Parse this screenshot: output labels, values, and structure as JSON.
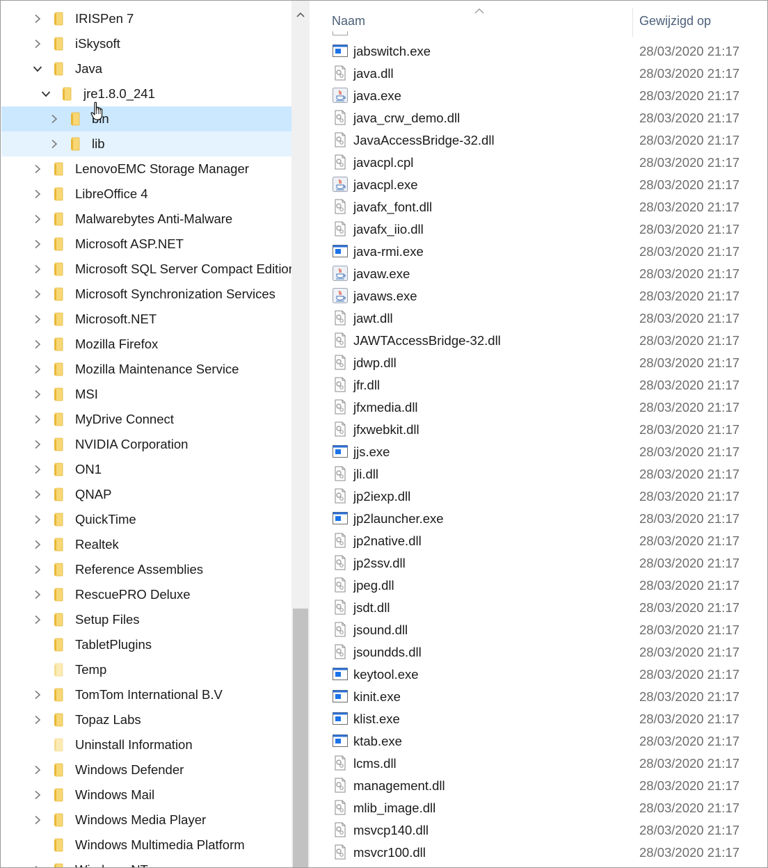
{
  "tree": {
    "items": [
      {
        "label": "IRISPen 7",
        "state": "collapsed",
        "depth": 0,
        "folder_style": "normal"
      },
      {
        "label": "iSkysoft",
        "state": "collapsed",
        "depth": 0,
        "folder_style": "normal"
      },
      {
        "label": "Java",
        "state": "expanded",
        "depth": 0,
        "folder_style": "normal"
      },
      {
        "label": "jre1.8.0_241",
        "state": "expanded",
        "depth": 1,
        "folder_style": "normal"
      },
      {
        "label": "bin",
        "state": "collapsed",
        "depth": 2,
        "folder_style": "normal",
        "selected": true
      },
      {
        "label": "lib",
        "state": "collapsed",
        "depth": 2,
        "folder_style": "normal",
        "hovered": true
      },
      {
        "label": "LenovoEMC Storage Manager",
        "state": "collapsed",
        "depth": 0,
        "folder_style": "normal"
      },
      {
        "label": "LibreOffice 4",
        "state": "collapsed",
        "depth": 0,
        "folder_style": "normal"
      },
      {
        "label": "Malwarebytes Anti-Malware",
        "state": "collapsed",
        "depth": 0,
        "folder_style": "normal"
      },
      {
        "label": "Microsoft ASP.NET",
        "state": "collapsed",
        "depth": 0,
        "folder_style": "normal"
      },
      {
        "label": "Microsoft SQL Server Compact Edition",
        "state": "collapsed",
        "depth": 0,
        "folder_style": "normal"
      },
      {
        "label": "Microsoft Synchronization Services",
        "state": "collapsed",
        "depth": 0,
        "folder_style": "normal"
      },
      {
        "label": "Microsoft.NET",
        "state": "collapsed",
        "depth": 0,
        "folder_style": "normal"
      },
      {
        "label": "Mozilla Firefox",
        "state": "collapsed",
        "depth": 0,
        "folder_style": "normal"
      },
      {
        "label": "Mozilla Maintenance Service",
        "state": "collapsed",
        "depth": 0,
        "folder_style": "normal"
      },
      {
        "label": "MSI",
        "state": "collapsed",
        "depth": 0,
        "folder_style": "normal"
      },
      {
        "label": "MyDrive Connect",
        "state": "collapsed",
        "depth": 0,
        "folder_style": "normal"
      },
      {
        "label": "NVIDIA Corporation",
        "state": "collapsed",
        "depth": 0,
        "folder_style": "normal"
      },
      {
        "label": "ON1",
        "state": "collapsed",
        "depth": 0,
        "folder_style": "normal"
      },
      {
        "label": "QNAP",
        "state": "collapsed",
        "depth": 0,
        "folder_style": "normal"
      },
      {
        "label": "QuickTime",
        "state": "collapsed",
        "depth": 0,
        "folder_style": "normal"
      },
      {
        "label": "Realtek",
        "state": "collapsed",
        "depth": 0,
        "folder_style": "normal"
      },
      {
        "label": "Reference Assemblies",
        "state": "collapsed",
        "depth": 0,
        "folder_style": "normal"
      },
      {
        "label": "RescuePRO Deluxe",
        "state": "collapsed",
        "depth": 0,
        "folder_style": "normal"
      },
      {
        "label": "Setup Files",
        "state": "collapsed",
        "depth": 0,
        "folder_style": "normal"
      },
      {
        "label": "TabletPlugins",
        "state": "leaf",
        "depth": 0,
        "folder_style": "normal"
      },
      {
        "label": "Temp",
        "state": "leaf",
        "depth": 0,
        "folder_style": "light"
      },
      {
        "label": "TomTom International B.V",
        "state": "collapsed",
        "depth": 0,
        "folder_style": "normal"
      },
      {
        "label": "Topaz Labs",
        "state": "collapsed",
        "depth": 0,
        "folder_style": "normal"
      },
      {
        "label": "Uninstall Information",
        "state": "leaf",
        "depth": 0,
        "folder_style": "light"
      },
      {
        "label": "Windows Defender",
        "state": "collapsed",
        "depth": 0,
        "folder_style": "normal"
      },
      {
        "label": "Windows Mail",
        "state": "collapsed",
        "depth": 0,
        "folder_style": "normal"
      },
      {
        "label": "Windows Media Player",
        "state": "collapsed",
        "depth": 0,
        "folder_style": "normal"
      },
      {
        "label": "Windows Multimedia Platform",
        "state": "leaf",
        "depth": 0,
        "folder_style": "normal"
      },
      {
        "label": "Windows NT",
        "state": "collapsed",
        "depth": 0,
        "folder_style": "normal"
      }
    ]
  },
  "files": {
    "columns": {
      "name": "Naam",
      "modified": "Gewijzigd op"
    },
    "rows": [
      {
        "name": "jabswitch.exe",
        "type": "exe",
        "date": "28/03/2020 21:17"
      },
      {
        "name": "java.dll",
        "type": "dll",
        "date": "28/03/2020 21:17"
      },
      {
        "name": "java.exe",
        "type": "java",
        "date": "28/03/2020 21:17"
      },
      {
        "name": "java_crw_demo.dll",
        "type": "dll",
        "date": "28/03/2020 21:17"
      },
      {
        "name": "JavaAccessBridge-32.dll",
        "type": "dll",
        "date": "28/03/2020 21:17"
      },
      {
        "name": "javacpl.cpl",
        "type": "dll",
        "date": "28/03/2020 21:17"
      },
      {
        "name": "javacpl.exe",
        "type": "java",
        "date": "28/03/2020 21:17"
      },
      {
        "name": "javafx_font.dll",
        "type": "dll",
        "date": "28/03/2020 21:17"
      },
      {
        "name": "javafx_iio.dll",
        "type": "dll",
        "date": "28/03/2020 21:17"
      },
      {
        "name": "java-rmi.exe",
        "type": "exe",
        "date": "28/03/2020 21:17"
      },
      {
        "name": "javaw.exe",
        "type": "java",
        "date": "28/03/2020 21:17"
      },
      {
        "name": "javaws.exe",
        "type": "java",
        "date": "28/03/2020 21:17"
      },
      {
        "name": "jawt.dll",
        "type": "dll",
        "date": "28/03/2020 21:17"
      },
      {
        "name": "JAWTAccessBridge-32.dll",
        "type": "dll",
        "date": "28/03/2020 21:17"
      },
      {
        "name": "jdwp.dll",
        "type": "dll",
        "date": "28/03/2020 21:17"
      },
      {
        "name": "jfr.dll",
        "type": "dll",
        "date": "28/03/2020 21:17"
      },
      {
        "name": "jfxmedia.dll",
        "type": "dll",
        "date": "28/03/2020 21:17"
      },
      {
        "name": "jfxwebkit.dll",
        "type": "dll",
        "date": "28/03/2020 21:17"
      },
      {
        "name": "jjs.exe",
        "type": "exe",
        "date": "28/03/2020 21:17"
      },
      {
        "name": "jli.dll",
        "type": "dll",
        "date": "28/03/2020 21:17"
      },
      {
        "name": "jp2iexp.dll",
        "type": "dll",
        "date": "28/03/2020 21:17"
      },
      {
        "name": "jp2launcher.exe",
        "type": "exe",
        "date": "28/03/2020 21:17"
      },
      {
        "name": "jp2native.dll",
        "type": "dll",
        "date": "28/03/2020 21:17"
      },
      {
        "name": "jp2ssv.dll",
        "type": "dll",
        "date": "28/03/2020 21:17"
      },
      {
        "name": "jpeg.dll",
        "type": "dll",
        "date": "28/03/2020 21:17"
      },
      {
        "name": "jsdt.dll",
        "type": "dll",
        "date": "28/03/2020 21:17"
      },
      {
        "name": "jsound.dll",
        "type": "dll",
        "date": "28/03/2020 21:17"
      },
      {
        "name": "jsoundds.dll",
        "type": "dll",
        "date": "28/03/2020 21:17"
      },
      {
        "name": "keytool.exe",
        "type": "exe",
        "date": "28/03/2020 21:17"
      },
      {
        "name": "kinit.exe",
        "type": "exe",
        "date": "28/03/2020 21:17"
      },
      {
        "name": "klist.exe",
        "type": "exe",
        "date": "28/03/2020 21:17"
      },
      {
        "name": "ktab.exe",
        "type": "exe",
        "date": "28/03/2020 21:17"
      },
      {
        "name": "lcms.dll",
        "type": "dll",
        "date": "28/03/2020 21:17"
      },
      {
        "name": "management.dll",
        "type": "dll",
        "date": "28/03/2020 21:17"
      },
      {
        "name": "mlib_image.dll",
        "type": "dll",
        "date": "28/03/2020 21:17"
      },
      {
        "name": "msvcp140.dll",
        "type": "dll",
        "date": "28/03/2020 21:17"
      },
      {
        "name": "msvcr100.dll",
        "type": "dll",
        "date": "28/03/2020 21:17"
      }
    ]
  },
  "colors": {
    "selected_row": "#cce8ff",
    "hover_row": "#e5f3ff",
    "folder": "#f8d775",
    "exe_blue": "#1a73e8",
    "date_text": "#6d6d6d",
    "header_text": "#4c607a"
  },
  "icons": {
    "chevron_collapsed": "chevron-right-icon",
    "chevron_expanded": "chevron-down-icon",
    "folder": "folder-icon",
    "exe": "exe-icon",
    "dll": "dll-icon",
    "java": "java-icon",
    "cursor": "hand-cursor-icon",
    "sort": "sort-ascending-icon"
  }
}
